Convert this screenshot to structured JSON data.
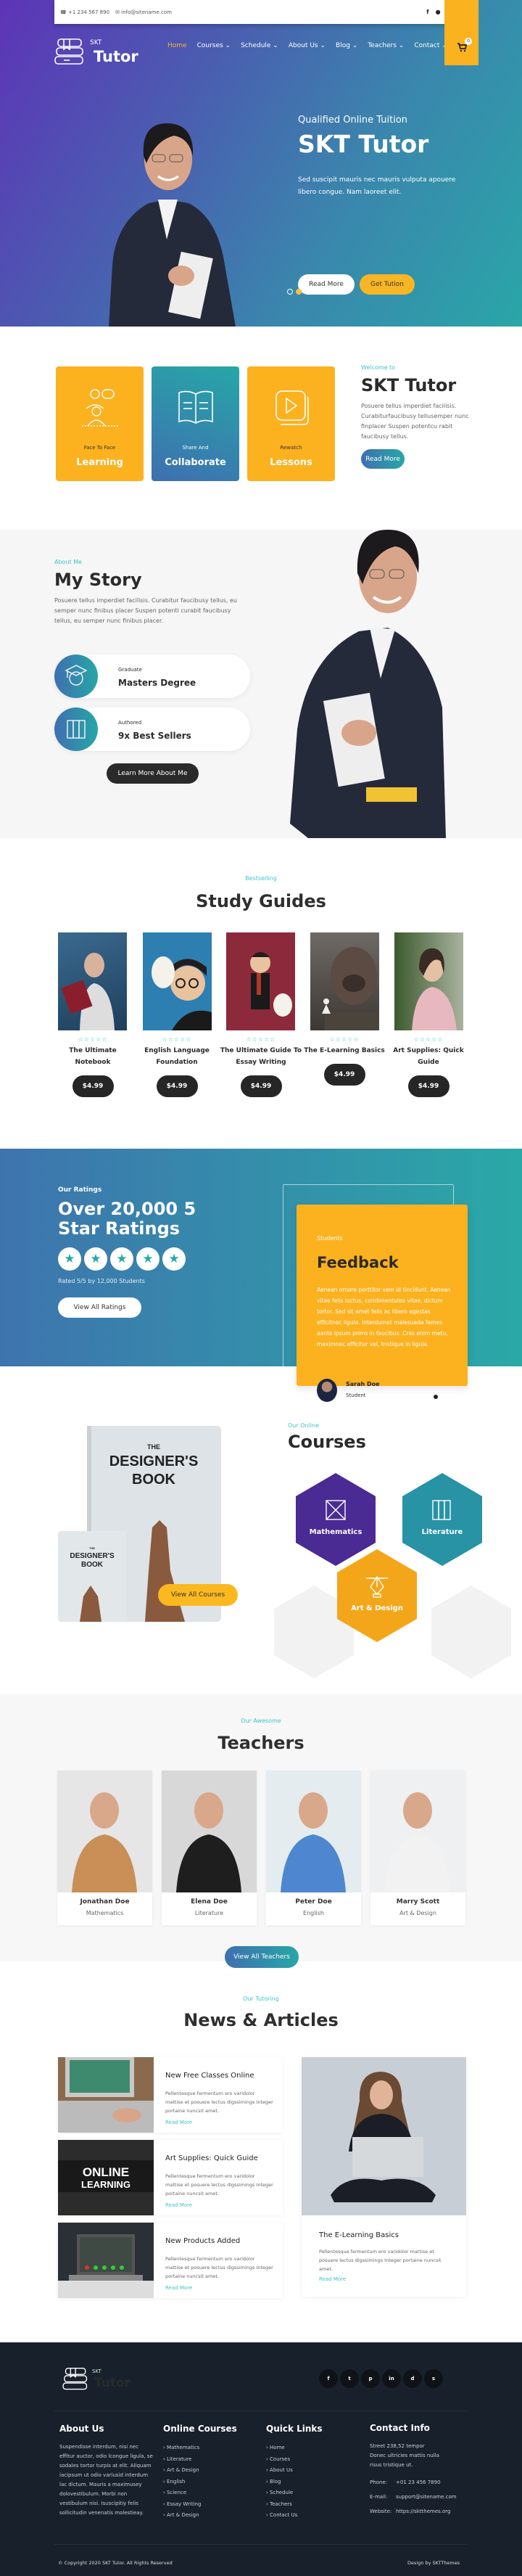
{
  "topbar": {
    "phone": "+1 234 567 890",
    "email": "info@sitename.com",
    "social_icons": [
      "facebook-icon",
      "pinterest-icon",
      "twitter-icon",
      "linkedin-icon"
    ]
  },
  "logo": {
    "small": "SKT",
    "big": "Tutor"
  },
  "nav": [
    {
      "label": "Home",
      "active": true
    },
    {
      "label": "Courses ⌄"
    },
    {
      "label": "Schedule ⌄"
    },
    {
      "label": "About Us ⌄"
    },
    {
      "label": "Blog ⌄"
    },
    {
      "label": "Teachers ⌄"
    },
    {
      "label": "Contact ⌄"
    }
  ],
  "cart": {
    "count": "0"
  },
  "hero": {
    "subtitle": "Qualified Online Tuition",
    "title": "SKT Tutor",
    "text": "Sed suscipit mauris nec mauris vulputa apouere libero congue. Nam laoreet elit.",
    "btn_read_more": "Read More",
    "btn_get_tution": "Get Tution",
    "slides": 3,
    "active_slide": 2
  },
  "features": [
    {
      "small": "Face To Face",
      "big": "Learning"
    },
    {
      "small": "Share And",
      "big": "Collaborate"
    },
    {
      "small": "Rewatch",
      "big": "Lessons"
    }
  ],
  "welcome": {
    "tag": "Welcome to",
    "title": "SKT Tutor",
    "text": "Posuere tellus imperdiet facilisis. Curabiturfaucibusy tellusemper nunc finplacer Suspen potentcu rabit faucibusy tellus.",
    "btn": "Read More"
  },
  "story": {
    "tag": "About Me",
    "title": "My Story",
    "text": "Posuere tellus imperdiet facilisis. Curabitur faucibusy tellus, eu semper nunc finibus placer Suspen potenti curabit faucibusy tellus, eu semper nunc finibus placer.",
    "stats": [
      {
        "label": "Graduate",
        "value": "Masters Degree"
      },
      {
        "label": "Authored",
        "value": "9x Best Sellers"
      }
    ],
    "btn": "Learn More About Me"
  },
  "guides": {
    "tag": "Bestselling",
    "title": "Study Guides",
    "stars": "☆☆☆☆☆",
    "items": [
      {
        "name": "The Ultimate Notebook",
        "price": "$4.99"
      },
      {
        "name": "English Language Foundation",
        "price": "$4.99"
      },
      {
        "name": "The Ultimate Guide To Essay Writing",
        "price": "$4.99"
      },
      {
        "name": "The E-Learning Basics",
        "price": "$4.99"
      },
      {
        "name": "Art Supplies: Quick Guide",
        "price": "$4.99"
      }
    ]
  },
  "ratings": {
    "tag": "Our Ratings",
    "title": "Over 20,000 5 Star Ratings",
    "stars": 5,
    "star_glyph": "★",
    "rated": "Rated 5/5 by 12,000 Students",
    "btn": "View All Ratings"
  },
  "feedback": {
    "tag": "Students",
    "title": "Feedback",
    "text": "Aenean ornare porttitor sem id tincidunt. Aenean vitae felis luctus, condimentuleo vitae, dictum tortor. Sed sit amet felis ac libero egestas efficitnec ligula. Interdumet malesuada fames aante ipsum prims in faucibus. Cras enim metu, maximnec efficitur vel, tristique in ligula.",
    "name": "Sarah Doe",
    "role": "Student",
    "slides": 3,
    "active_slide": 2
  },
  "courses": {
    "tag": "Our Online",
    "title": "Courses",
    "btn": "View All Courses",
    "book_title_1": "THE",
    "book_title_2": "DESIGNER'S",
    "book_title_3": "BOOK",
    "items": [
      {
        "label": "Mathematics",
        "color": "#4a2a93"
      },
      {
        "label": "Literature",
        "color": "#2793a5"
      },
      {
        "label": "Art & Design",
        "color": "#f4a61a"
      }
    ]
  },
  "teachers": {
    "tag": "Our Awesome",
    "title": "Teachers",
    "items": [
      {
        "name": "Jonathan Doe",
        "role": "Mathematics"
      },
      {
        "name": "Elena Doe",
        "role": "Literature"
      },
      {
        "name": "Peter Doe",
        "role": "English"
      },
      {
        "name": "Marry Scott",
        "role": "Art & Design"
      }
    ],
    "btn": "View All Teachers"
  },
  "news": {
    "tag": "Our Tutoring",
    "title": "News & Articles",
    "read_more": "Read More",
    "online_learning_1": "ONLINE",
    "online_learning_2": "LEARNING",
    "items": [
      {
        "title": "New Free Classes Online",
        "text": "Pellentesque fermentum ero varidolor mattise et posuere lectus digssimings Integer portaine nuncsit amet."
      },
      {
        "title": "Art Supplies: Quick Guide",
        "text": "Pellentesque fermentum ero varidolor mattise et posuere lectus digssimings Integer portaine nuncsit amet."
      },
      {
        "title": "New Products Added",
        "text": "Pellentesque fermentum ero varidolor mattise et posuere lectus digssimings Integer portaine nuncsit amet."
      }
    ],
    "featured": {
      "title": "The E-Learning Basics",
      "text": "Pellentesque fermentum ero varidolor mattise et posuere lectus digssimings Integer portaine nuncsit amet."
    }
  },
  "footer": {
    "social": [
      "f",
      "t",
      "p",
      "in",
      "d",
      "s"
    ],
    "about_title": "About Us",
    "about_text": "Suspendisse interdum, nisi nec effitur auctor, odio lcongue ligula, se sodales tortor turpis at elit. Aliquam iacipsum ut odio variusid interdum lac dictum. Mauris a maximusey dolovestibulum. Morbi non vestibulum nisi. Isuscipitiy felis sollicitudin venenatis molestieay.",
    "courses_title": "Online Courses",
    "courses": [
      "Mathematics",
      "Literature",
      "Art & Design",
      "English",
      "Science",
      "Essay Writing",
      "Art & Design"
    ],
    "links_title": "Quick Links",
    "links": [
      "Home",
      "Courses",
      "About Us",
      "Blog",
      "Schedule",
      "Teachers",
      "Contact Us"
    ],
    "contact_title": "Contact Info",
    "address_1": "Street 238,52 tempor",
    "address_2": "Donec ultricies mattis nulla",
    "address_3": "risus tristique ut.",
    "phone_label": "Phone:",
    "phone": "+01 23 456 7890",
    "email_label": "E-mail:",
    "email": "support@sitename.com",
    "website_label": "Website:",
    "website": "https://sktthemes.org",
    "copyright": "© Copyright 2020 SKT Tutor. All Rights Reserved",
    "design": "Design by SKTThemes"
  },
  "colors": {
    "accent_teal": "#3ec4c7",
    "accent_yellow": "#fbb21f",
    "dark": "#18212b"
  }
}
